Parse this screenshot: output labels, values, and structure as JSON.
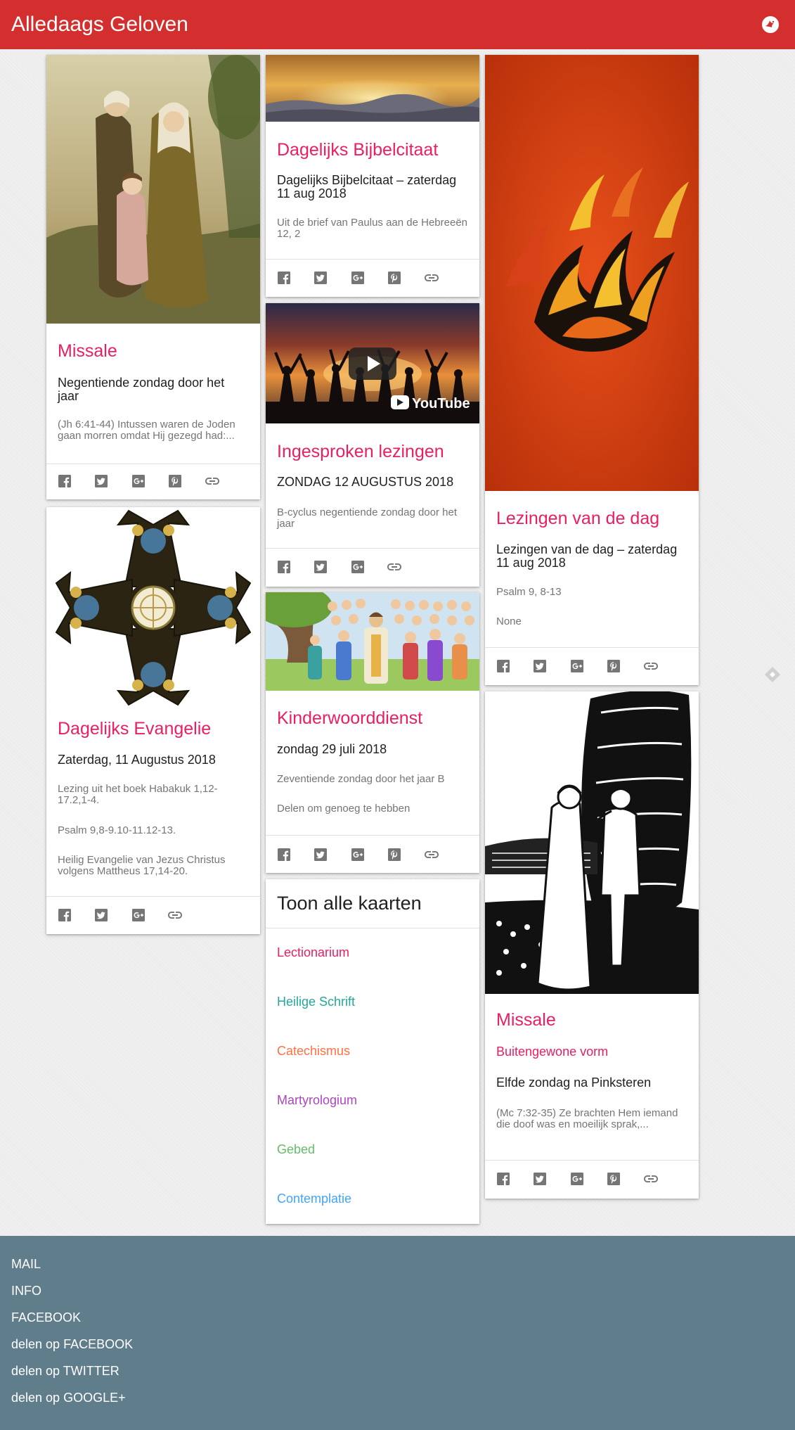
{
  "app": {
    "title": "Alledaags Geloven"
  },
  "cards": {
    "missale1": {
      "title": "Missale",
      "subtitle": "Negentiende zondag door het jaar",
      "excerpt": "(Jh 6:41-44) Intussen waren de Joden gaan morren omdat Hij gezegd had:..."
    },
    "evangelie": {
      "title": "Dagelijks Evangelie",
      "subtitle": "Zaterdag, 11 Augustus 2018",
      "lines": [
        "Lezing uit het boek Habakuk 1,12-17.2,1-4.",
        "Psalm 9,8-9.10-11.12-13.",
        "Heilig Evangelie van Jezus Christus volgens Mattheus 17,14-20."
      ]
    },
    "bijbelcitaat": {
      "title": "Dagelijks Bijbelcitaat",
      "subtitle": "Dagelijks Bijbelcitaat – zaterdag 11 aug 2018",
      "excerpt": "Uit de brief van Paulus aan de Hebreeën 12, 2"
    },
    "ingesproken": {
      "title": "Ingesproken lezingen",
      "subtitle": "ZONDAG 12 AUGUSTUS 2018",
      "excerpt": "B-cyclus negentiende zondag door het jaar",
      "video_brand": "YouTube"
    },
    "kinder": {
      "title": "Kinderwoorddienst",
      "subtitle": "zondag 29 juli 2018",
      "lines": [
        "Zeventiende zondag door het jaar B",
        "Delen om genoeg te hebben"
      ]
    },
    "lezingen": {
      "title": "Lezingen van de dag",
      "subtitle": "Lezingen van de dag – zaterdag 11 aug 2018",
      "lines": [
        "Psalm 9, 8-13",
        "None"
      ]
    },
    "missale2": {
      "title": "Missale",
      "form": "Buitengewone vorm",
      "subtitle": "Elfde zondag na Pinksteren",
      "excerpt": "(Mc 7:32-35) Ze brachten Hem iemand die doof was en moeilijk sprak,..."
    }
  },
  "all_cards": {
    "title": "Toon alle kaarten",
    "links": [
      {
        "label": "Lectionarium",
        "color": "#e91e63"
      },
      {
        "label": "Heilige Schrift",
        "color": "#26a69a"
      },
      {
        "label": "Catechismus",
        "color": "#ff7043"
      },
      {
        "label": "Martyrologium",
        "color": "#ab47bc"
      },
      {
        "label": "Gebed",
        "color": "#66bb6a"
      },
      {
        "label": "Contemplatie",
        "color": "#42a5f5"
      }
    ]
  },
  "share_icons": [
    "facebook-icon",
    "twitter-icon",
    "google-plus-icon",
    "pinterest-icon",
    "link-icon"
  ],
  "footer": {
    "links": [
      "MAIL",
      "INFO",
      "FACEBOOK",
      "delen op FACEBOOK",
      "delen op TWITTER",
      "delen op GOOGLE+"
    ]
  },
  "colors": {
    "appbar": "#d32f2f",
    "card_title": "#e91e63",
    "footer": "#607d8b"
  }
}
